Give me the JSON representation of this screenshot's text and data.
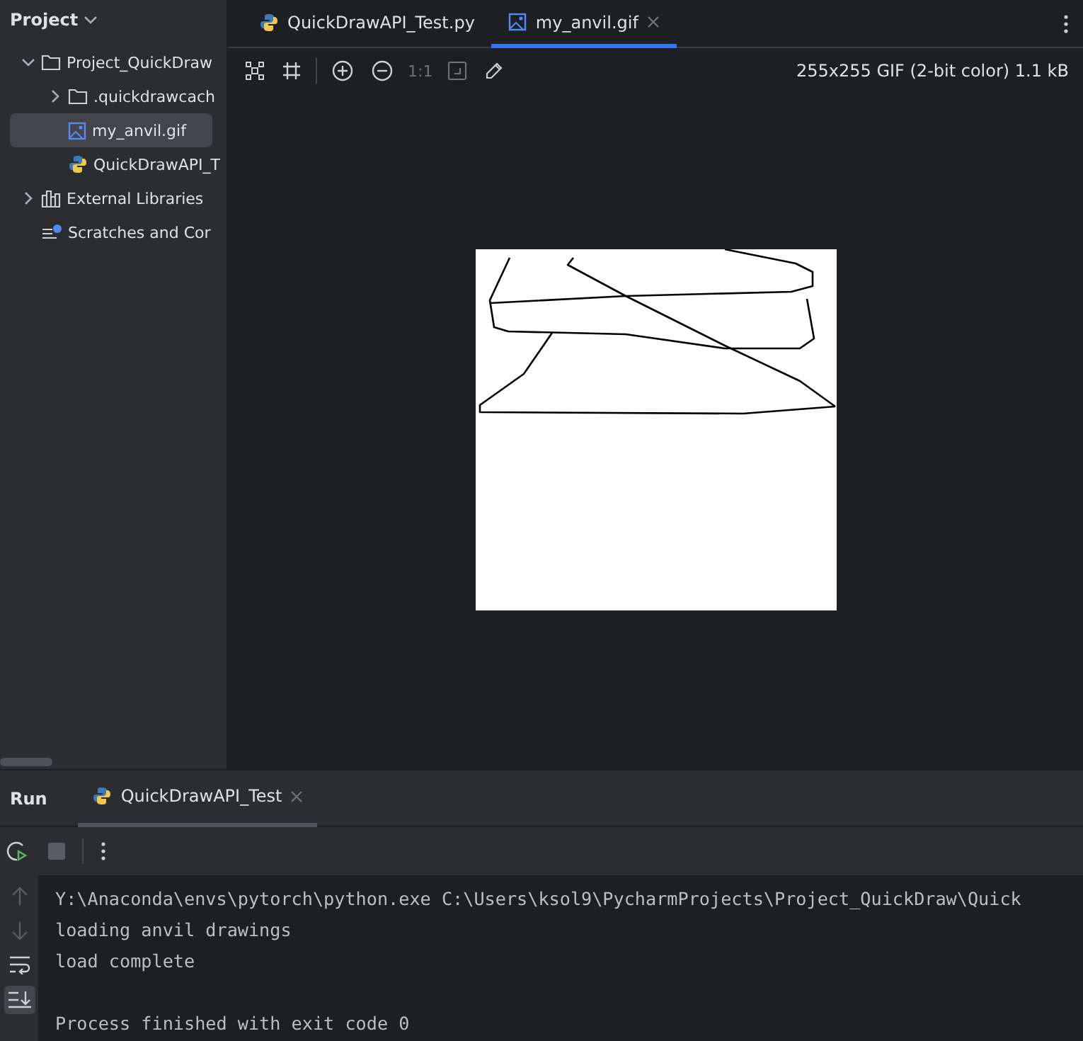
{
  "sidebar": {
    "title": "Project",
    "tree": [
      {
        "label": "Project_QuickDraw",
        "kind": "folder",
        "expanded": true,
        "selected": false,
        "children": [
          {
            "label": ".quickdrawcach",
            "kind": "folder",
            "expanded": false,
            "selected": false
          },
          {
            "label": "my_anvil.gif",
            "kind": "image",
            "selected": true
          },
          {
            "label": "QuickDrawAPI_T",
            "kind": "python",
            "selected": false
          }
        ]
      },
      {
        "label": "External Libraries",
        "kind": "library",
        "expanded": false,
        "selected": false
      },
      {
        "label": "Scratches and Cor",
        "kind": "scratch",
        "selected": false
      }
    ]
  },
  "editor_tabs": [
    {
      "label": "QuickDrawAPI_Test.py",
      "kind": "python",
      "selected": false,
      "closable": false
    },
    {
      "label": "my_anvil.gif",
      "kind": "image",
      "selected": true,
      "closable": true
    }
  ],
  "image_toolbar": {
    "zoom_label": "1:1",
    "info": "255x255 GIF (2-bit color) 1.1 kB"
  },
  "run_panel": {
    "title": "Run",
    "tabs": [
      {
        "label": "QuickDrawAPI_Test",
        "selected": true,
        "closable": true
      }
    ],
    "console_blocks": [
      {
        "lines": [
          "Y:\\Anaconda\\envs\\pytorch\\python.exe C:\\Users\\ksol9\\PycharmProjects\\Project_QuickDraw\\Quick",
          "loading anvil drawings",
          "load complete"
        ]
      },
      {
        "lines": [
          "Process finished with exit code 0"
        ]
      }
    ]
  }
}
